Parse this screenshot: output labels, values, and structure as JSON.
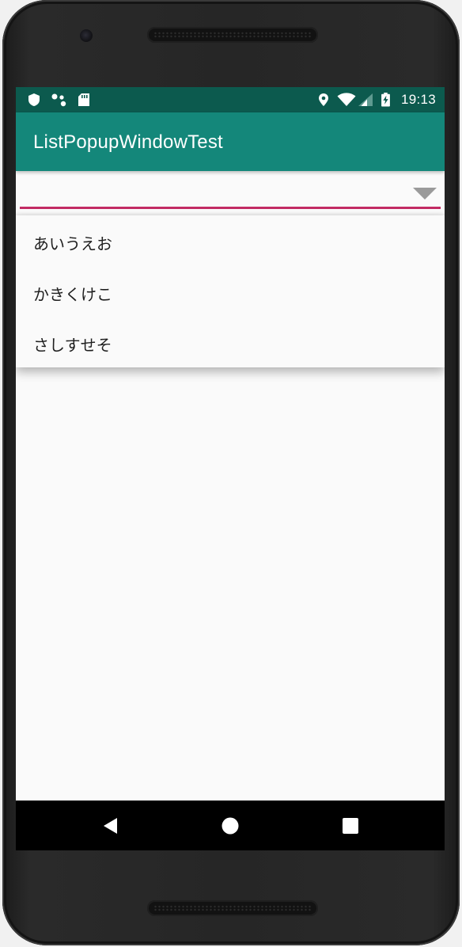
{
  "status_bar": {
    "time": "19:13",
    "left_icons": [
      "shield-icon",
      "dots-icon",
      "sd-card-icon"
    ],
    "right_icons": [
      "location-icon",
      "wifi-icon",
      "signal-icon",
      "battery-charging-icon"
    ],
    "background_color": "#0c5a4e"
  },
  "app_bar": {
    "title": "ListPopupWindowTest",
    "background_color": "#14877a"
  },
  "spinner": {
    "underline_color": "#c22b63",
    "arrow_icon": "dropdown-arrow-icon"
  },
  "popup": {
    "items": [
      {
        "label": "あいうえお"
      },
      {
        "label": "かきくけこ"
      },
      {
        "label": "さしすせそ"
      }
    ]
  },
  "nav_bar": {
    "buttons": [
      "back-icon",
      "home-icon",
      "recents-icon"
    ]
  }
}
